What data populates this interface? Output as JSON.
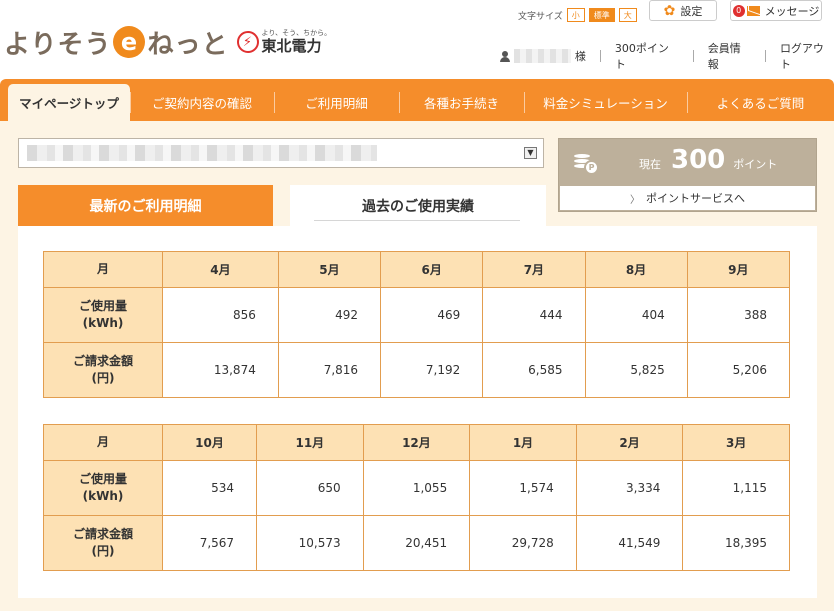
{
  "logo": {
    "pre": "よりそう",
    "e": "e",
    "post": "ねっと"
  },
  "utility": {
    "tagline": "より、そう、ちから。",
    "name": "東北電力",
    "mark": "⚡"
  },
  "font_size": {
    "label": "文字サイズ",
    "small": "小",
    "standard": "標準",
    "large": "大",
    "selected": "標準"
  },
  "header_buttons": {
    "settings": "設定",
    "messages": "メッセージ",
    "badge": "0"
  },
  "user_links": {
    "suffix": "様",
    "points": "300ポイント",
    "member_info": "会員情報",
    "logout": "ログアウト"
  },
  "nav": [
    {
      "label": "マイページトップ",
      "active": true
    },
    {
      "label": "ご契約内容の確認",
      "active": false
    },
    {
      "label": "ご利用明細",
      "active": false
    },
    {
      "label": "各種お手続き",
      "active": false
    },
    {
      "label": "料金シミュレーション",
      "active": false
    },
    {
      "label": "よくあるご質問",
      "active": false
    }
  ],
  "points_box": {
    "now": "現在",
    "value": "300",
    "unit": "ポイント",
    "link": "ポイントサービスへ"
  },
  "tabs": {
    "latest": "最新のご利用明細",
    "past": "過去のご使用実績"
  },
  "table1": {
    "header_label": "月",
    "months": [
      "4月",
      "5月",
      "6月",
      "7月",
      "8月",
      "9月"
    ],
    "usage_label": [
      "ご使用量",
      "(kWh)"
    ],
    "usage": [
      "856",
      "492",
      "469",
      "444",
      "404",
      "388"
    ],
    "charge_label": [
      "ご請求金額",
      "(円)"
    ],
    "charge": [
      "13,874",
      "7,816",
      "7,192",
      "6,585",
      "5,825",
      "5,206"
    ]
  },
  "table2": {
    "header_label": "月",
    "months": [
      "10月",
      "11月",
      "12月",
      "1月",
      "2月",
      "3月"
    ],
    "usage_label": [
      "ご使用量",
      "(kWh)"
    ],
    "usage": [
      "534",
      "650",
      "1,055",
      "1,574",
      "3,334",
      "1,115"
    ],
    "charge_label": [
      "ご請求金額",
      "(円)"
    ],
    "charge": [
      "7,567",
      "10,573",
      "20,451",
      "29,728",
      "41,549",
      "18,395"
    ]
  }
}
